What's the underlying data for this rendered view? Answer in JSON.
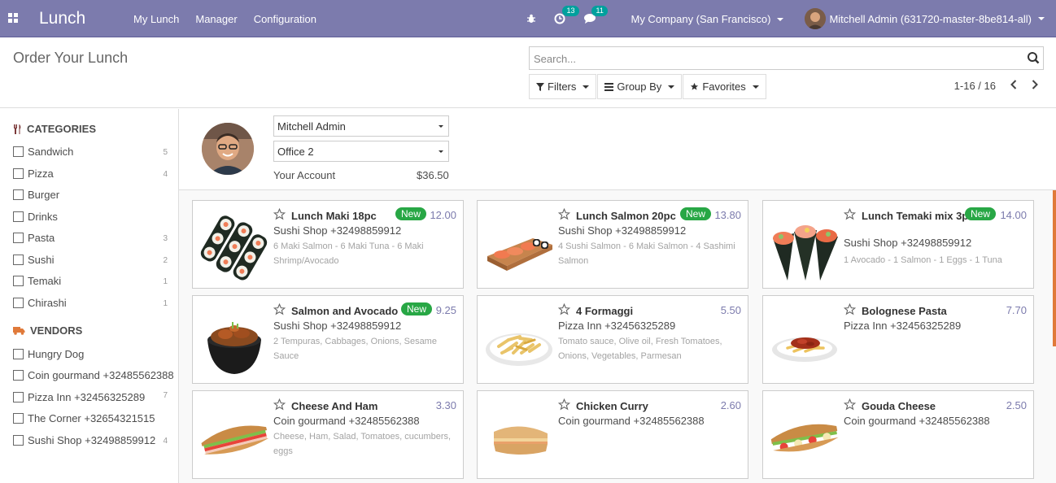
{
  "navbar": {
    "app_name": "Lunch",
    "menu": [
      "My Lunch",
      "Manager",
      "Configuration"
    ],
    "activity_count": "13",
    "messages_count": "11",
    "company": "My Company (San Francisco)",
    "user": "Mitchell Admin (631720-master-8be814-all)"
  },
  "control_panel": {
    "title": "Order Your Lunch",
    "search_placeholder": "Search...",
    "filters": "Filters",
    "group_by": "Group By",
    "favorites": "Favorites",
    "pager": "1-16 / 16"
  },
  "sidebar": {
    "categories_title": "CATEGORIES",
    "categories": [
      {
        "label": "Sandwich",
        "count": "5"
      },
      {
        "label": "Pizza",
        "count": "4"
      },
      {
        "label": "Burger",
        "count": ""
      },
      {
        "label": "Drinks",
        "count": ""
      },
      {
        "label": "Pasta",
        "count": "3"
      },
      {
        "label": "Sushi",
        "count": "2"
      },
      {
        "label": "Temaki",
        "count": "1"
      },
      {
        "label": "Chirashi",
        "count": "1"
      }
    ],
    "vendors_title": "VENDORS",
    "vendors": [
      {
        "label": "Hungry Dog",
        "count": ""
      },
      {
        "label": "Coin gourmand +32485562388",
        "count": ""
      },
      {
        "label": "Pizza Inn +32456325289",
        "count": "7"
      },
      {
        "label": "The Corner +32654321515",
        "count": ""
      },
      {
        "label": "Sushi Shop +32498859912",
        "count": "4"
      }
    ]
  },
  "user_panel": {
    "user": "Mitchell Admin",
    "location": "Office 2",
    "account_label": "Your Account",
    "account_value": "$36.50"
  },
  "products": [
    {
      "name": "Lunch Maki 18pc",
      "new": "New",
      "price": "12.00",
      "vendor": "Sushi Shop +32498859912",
      "desc": "6 Maki Salmon - 6 Maki Tuna - 6 Maki Shrimp/Avocado",
      "image": "maki-rolls"
    },
    {
      "name": "Lunch Salmon 20pc",
      "new": "New",
      "price": "13.80",
      "vendor": "Sushi Shop +32498859912",
      "desc": "4 Sushi Salmon - 6 Maki Salmon - 4 Sashimi Salmon",
      "image": "sushi-board"
    },
    {
      "name": "Lunch Temaki mix 3pc",
      "new": "New",
      "price": "14.00",
      "vendor": "Sushi Shop +32498859912",
      "desc": "1 Avocado - 1 Salmon - 1 Eggs - 1 Tuna",
      "image": "temaki-cones"
    },
    {
      "name": "Salmon and Avocado",
      "new": "New",
      "price": "9.25",
      "vendor": "Sushi Shop +32498859912",
      "desc": "2 Tempuras, Cabbages, Onions, Sesame Sauce",
      "image": "poke-bowl"
    },
    {
      "name": "4 Formaggi",
      "new": "",
      "price": "5.50",
      "vendor": "Pizza Inn +32456325289",
      "desc": "Tomato sauce, Olive oil, Fresh Tomatoes, Onions, Vegetables, Parmesan",
      "image": "pasta-plate"
    },
    {
      "name": "Bolognese Pasta",
      "new": "",
      "price": "7.70",
      "vendor": "Pizza Inn +32456325289",
      "desc": "",
      "image": "bolognese-plate"
    },
    {
      "name": "Cheese And Ham",
      "new": "",
      "price": "3.30",
      "vendor": "Coin gourmand +32485562388",
      "desc": "Cheese, Ham, Salad, Tomatoes, cucumbers, eggs",
      "image": "baguette-sandwich"
    },
    {
      "name": "Chicken Curry",
      "new": "",
      "price": "2.60",
      "vendor": "Coin gourmand +32485562388",
      "desc": "",
      "image": "ciabatta-sandwich"
    },
    {
      "name": "Gouda Cheese",
      "new": "",
      "price": "2.50",
      "vendor": "Coin gourmand +32485562388",
      "desc": "",
      "image": "gouda-sandwich"
    }
  ],
  "colors": {
    "navbar": "#7c7bad",
    "badge": "#00a09d",
    "new_badge": "#28a745",
    "price": "#7c7bad"
  }
}
